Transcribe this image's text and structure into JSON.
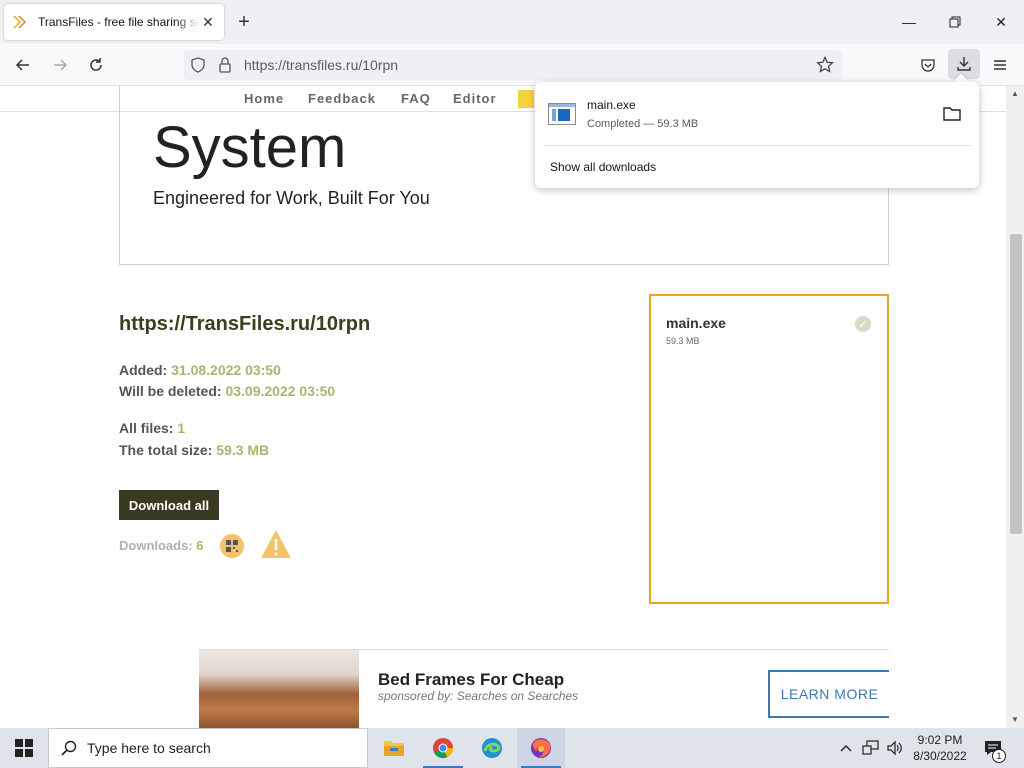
{
  "browser": {
    "tab_title": "TransFiles - free file sharing service",
    "url": "https://transfiles.ru/10rpn"
  },
  "site_nav": {
    "items": [
      "Home",
      "Feedback",
      "FAQ",
      "Editor"
    ]
  },
  "hero": {
    "title": "System",
    "subtitle": "Engineered for Work, Built For You"
  },
  "share": {
    "link": "https://TransFiles.ru/10rpn",
    "added_label": "Added:",
    "added_value": "31.08.2022 03:50",
    "deleted_label": "Will be deleted:",
    "deleted_value": "03.09.2022 03:50",
    "files_label": "All files:",
    "files_value": "1",
    "size_label": "The total size:",
    "size_value": "59.3 MB",
    "download_all": "Download all",
    "downloads_label": "Downloads:",
    "downloads_value": "6"
  },
  "file_card": {
    "name": "main.exe",
    "size": "59.3 MB"
  },
  "ad": {
    "title": "Bed Frames For Cheap",
    "sponsor": "sponsored by: Searches on Searches",
    "button": "LEARN MORE"
  },
  "downloads_panel": {
    "filename": "main.exe",
    "status": "Completed — 59.3 MB",
    "show_all": "Show all downloads"
  },
  "taskbar": {
    "search_placeholder": "Type here to search",
    "time": "9:02 PM",
    "date": "8/30/2022",
    "notification_count": "1"
  },
  "colors": {
    "accent_dark": "#3a3a22",
    "accent_value": "#a8b570",
    "card_border": "#e6a820",
    "ad_button": "#3a78b5"
  }
}
